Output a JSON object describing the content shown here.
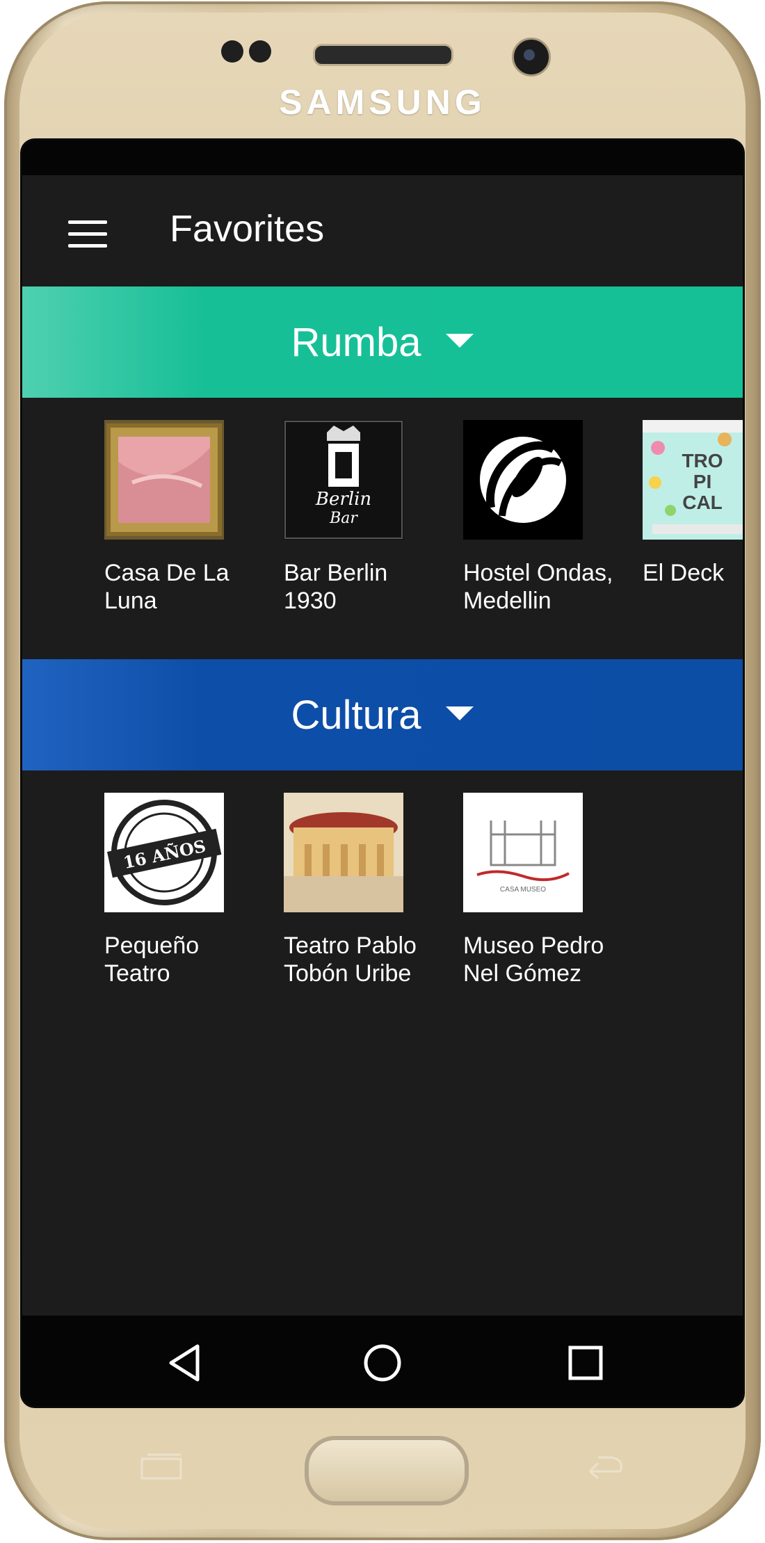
{
  "device": {
    "brand": "SAMSUNG"
  },
  "app_bar": {
    "title": "Favorites"
  },
  "sections": [
    {
      "title": "Rumba",
      "color": "#17bf97",
      "items": [
        {
          "label": "Casa De La\nLuna"
        },
        {
          "label": "Bar Berlin\n1930",
          "thumb_text": [
            "Berlin",
            "Bar"
          ]
        },
        {
          "label": "Hostel Ondas,\nMedellin"
        },
        {
          "label": "El Deck",
          "thumb_text": [
            "TRO",
            "PI",
            "CAL"
          ]
        }
      ]
    },
    {
      "title": "Cultura",
      "color": "#0d4ea8",
      "items": [
        {
          "label": "Pequeño\nTeatro",
          "thumb_text": [
            "16 AÑOS"
          ]
        },
        {
          "label": "Teatro Pablo\nTobón Uribe"
        },
        {
          "label": "Museo Pedro\nNel Gómez",
          "thumb_text": [
            "CASA MUSEO"
          ]
        }
      ]
    }
  ],
  "nav": {
    "back": "back-icon",
    "home": "home-circle-icon",
    "recents": "recents-square-icon"
  }
}
